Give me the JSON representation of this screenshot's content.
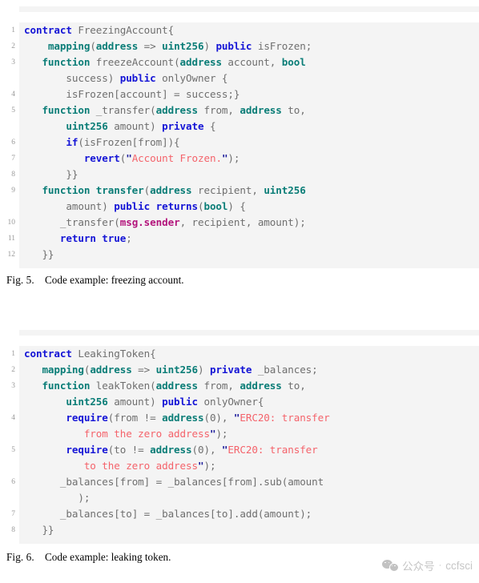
{
  "figure5": {
    "caption_label": "Fig. 5.",
    "caption_text": "Code example: freezing account.",
    "language": "solidity",
    "lines": [
      {
        "num": "1",
        "plain": "contract FreezingAccount{"
      },
      {
        "num": "2",
        "plain": "    mapping(address => uint256) public isFrozen;"
      },
      {
        "num": "3",
        "plain": "    function freezeAccount(address account, bool success) public onlyOwner {"
      },
      {
        "num": "4",
        "plain": "        isFrozen[account] = success;}"
      },
      {
        "num": "5",
        "plain": "    function _transfer(address from, address to, uint256 amount) private {"
      },
      {
        "num": "6",
        "plain": "        if(isFrozen[from]){"
      },
      {
        "num": "7",
        "plain": "            revert(\"Account Frozen.\");"
      },
      {
        "num": "8",
        "plain": "        }}"
      },
      {
        "num": "9",
        "plain": "    function transfer(address recipient, uint256 amount) public returns(bool) {"
      },
      {
        "num": "10",
        "plain": "        _transfer(msg.sender, recipient, amount);"
      },
      {
        "num": "11",
        "plain": "        return true;"
      },
      {
        "num": "12",
        "plain": "    }}"
      }
    ]
  },
  "figure6": {
    "caption_label": "Fig. 6.",
    "caption_text": "Code example: leaking token.",
    "language": "solidity",
    "lines": [
      {
        "num": "1",
        "plain": "contract LeakingToken{"
      },
      {
        "num": "2",
        "plain": "    mapping(address => uint256) private _balances;"
      },
      {
        "num": "3",
        "plain": "    function leakToken(address from, address to, uint256 amount) public onlyOwner{"
      },
      {
        "num": "4",
        "plain": "        require(from != address(0), \"ERC20: transfer from the zero address\");"
      },
      {
        "num": "5",
        "plain": "        require(to != address(0), \"ERC20: transfer to the zero address\");"
      },
      {
        "num": "6",
        "plain": "        _balances[from] = _balances[from].sub(amount);"
      },
      {
        "num": "7",
        "plain": "        _balances[to] = _balances[to].add(amount);"
      },
      {
        "num": "8",
        "plain": "    }}"
      }
    ]
  },
  "watermark": {
    "icon": "wechat-icon",
    "label": "公众号",
    "separator": "·",
    "account": "ccfsci"
  },
  "colors": {
    "code_background": "#f4f4f4",
    "page_background": "#ffffff",
    "keyword_blue": "#1414d6",
    "type_teal": "#0a7d77",
    "string_red": "#f4636b",
    "builtin_magenta": "#b3157c",
    "identifier_gray": "#6f6f6f",
    "line_number_gray": "#9a9a9a",
    "watermark_gray": "#c6c6c6"
  }
}
